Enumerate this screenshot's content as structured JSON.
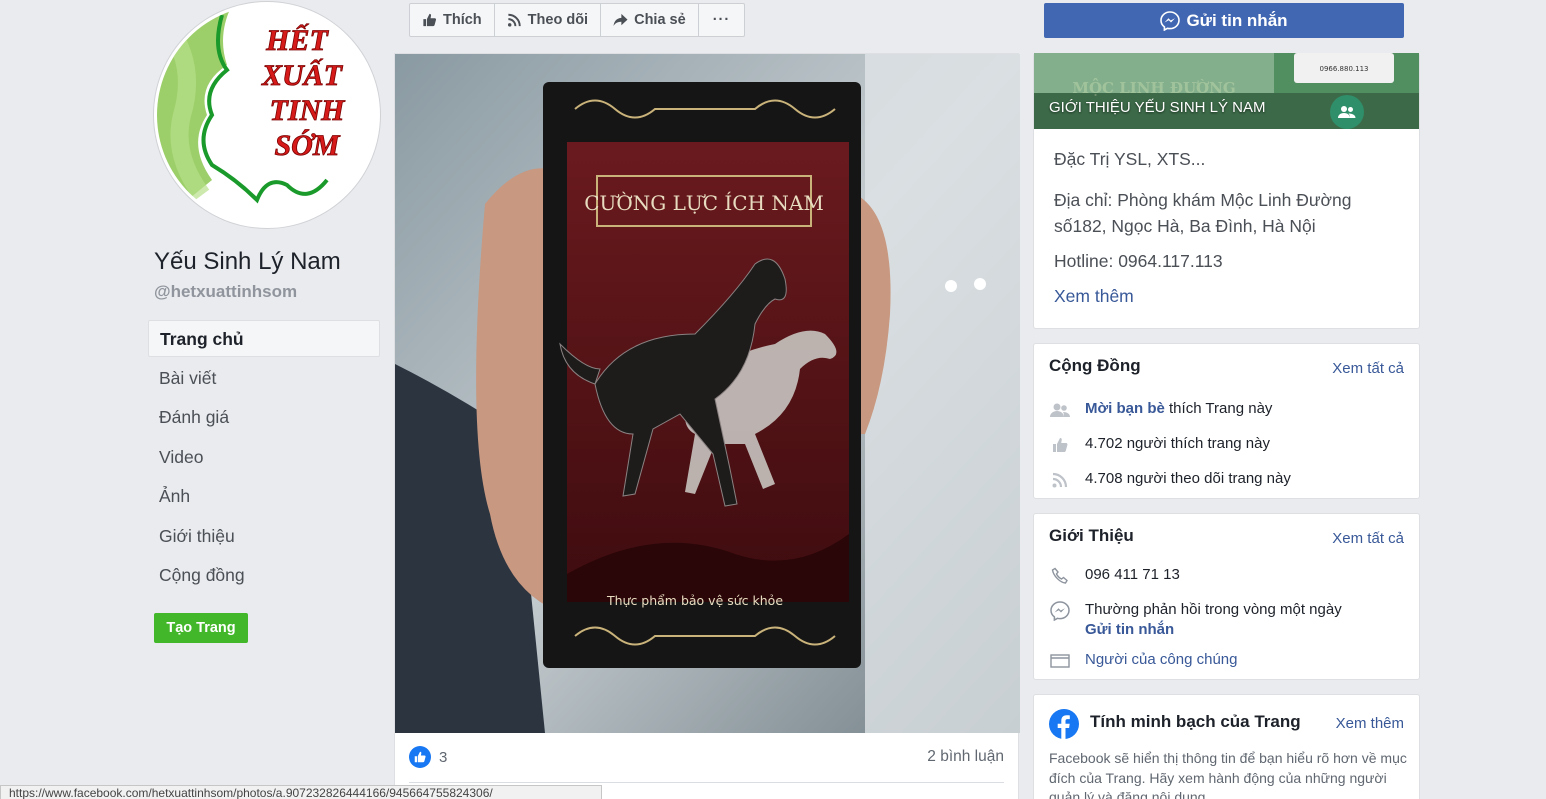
{
  "page": {
    "name": "Yếu Sinh Lý Nam",
    "handle": "@hetxuattinhsom",
    "avatar_text": [
      "HẾT",
      "XUẤT",
      "TINH",
      "SỚM"
    ]
  },
  "nav": {
    "items": [
      {
        "label": "Trang chủ",
        "active": true
      },
      {
        "label": "Bài viết"
      },
      {
        "label": "Đánh giá"
      },
      {
        "label": "Video"
      },
      {
        "label": "Ảnh"
      },
      {
        "label": "Giới thiệu"
      },
      {
        "label": "Cộng đồng"
      }
    ],
    "create_page": "Tạo Trang"
  },
  "actions": {
    "like": "Thích",
    "follow": "Theo dõi",
    "share": "Chia sẻ",
    "more": "···"
  },
  "send_message": "Gửi tin nhắn",
  "post": {
    "product_title": "CƯỜNG LỰC ÍCH NAM",
    "product_subtitle": "Thực phẩm bảo vệ sức khỏe",
    "reaction_count": "3",
    "comments": "2 bình luận"
  },
  "cover": {
    "title": "GIỚI THIỆU YẾU SINH LÝ NAM",
    "sign_text": "MỘC LINH ĐƯỜNG",
    "phone_tag": "0966.880.113"
  },
  "about": {
    "line1": "Đặc Trị YSL, XTS...",
    "line2": "Địa chỉ: Phòng khám Mộc Linh Đường",
    "line3": "số182, Ngọc Hà, Ba Đình, Hà Nội",
    "line4": "Hotline: 0964.117.113",
    "see_more": "Xem thêm"
  },
  "community": {
    "title": "Cộng Đồng",
    "see_all": "Xem tất cả",
    "invite_link": "Mời bạn bè",
    "invite_rest": " thích Trang này",
    "likes": "4.702 người thích trang này",
    "follows": "4.708 người theo dõi trang này"
  },
  "intro": {
    "title": "Giới Thiệu",
    "see_all": "Xem tất cả",
    "phone": "096 411 71 13",
    "response": "Thường phản hồi trong vòng một ngày",
    "send_message": "Gửi tin nhắn",
    "category": "Người của công chúng"
  },
  "transparency": {
    "title": "Tính minh bạch của Trang",
    "see_more": "Xem thêm",
    "text": "Facebook sẽ hiển thị thông tin để bạn hiểu rõ hơn về mục đích của Trang. Hãy xem hành động của những người quản lý và đăng nội dung."
  },
  "statusbar": "https://www.facebook.com/hetxuattinhsom/photos/a.907232826444166/945664755824306/",
  "colors": {
    "brand_blue": "#4267b2",
    "link": "#385898",
    "green": "#42b72a",
    "box_red": "#5e1518"
  }
}
